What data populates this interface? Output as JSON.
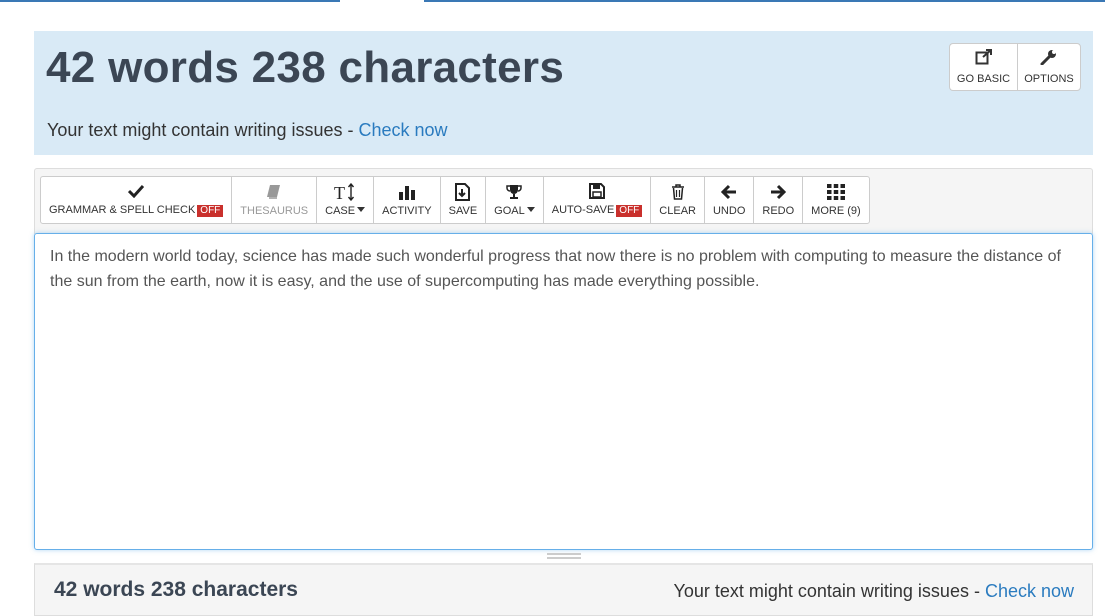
{
  "header": {
    "title": "42 words 238 characters",
    "issues_text": "Your text might contain writing issues - ",
    "check_link": "Check now",
    "buttons": {
      "go_basic": "GO BASIC",
      "options": "OPTIONS"
    }
  },
  "toolbar": {
    "grammar": {
      "label": "GRAMMAR & SPELL CHECK",
      "status": "OFF"
    },
    "thesaurus": "THESAURUS",
    "case": "CASE",
    "activity": "ACTIVITY",
    "save": "SAVE",
    "goal": "GOAL",
    "autosave": {
      "label": "AUTO-SAVE",
      "status": "OFF"
    },
    "clear": "CLEAR",
    "undo": "UNDO",
    "redo": "REDO",
    "more": "MORE (9)"
  },
  "editor": {
    "text": "In the modern world today, science has made such wonderful progress that now there is no problem with computing to measure the distance of the sun from the earth, now it is easy, and the use of supercomputing has made everything possible."
  },
  "footer": {
    "count": "42 words 238 characters",
    "issues_text": "Your text might contain writing issues - ",
    "check_link": "Check now"
  },
  "colors": {
    "header_bg": "#d9eaf6",
    "link": "#2a7bbf",
    "off_badge": "#c9302c",
    "editor_focus": "#66afe9"
  }
}
